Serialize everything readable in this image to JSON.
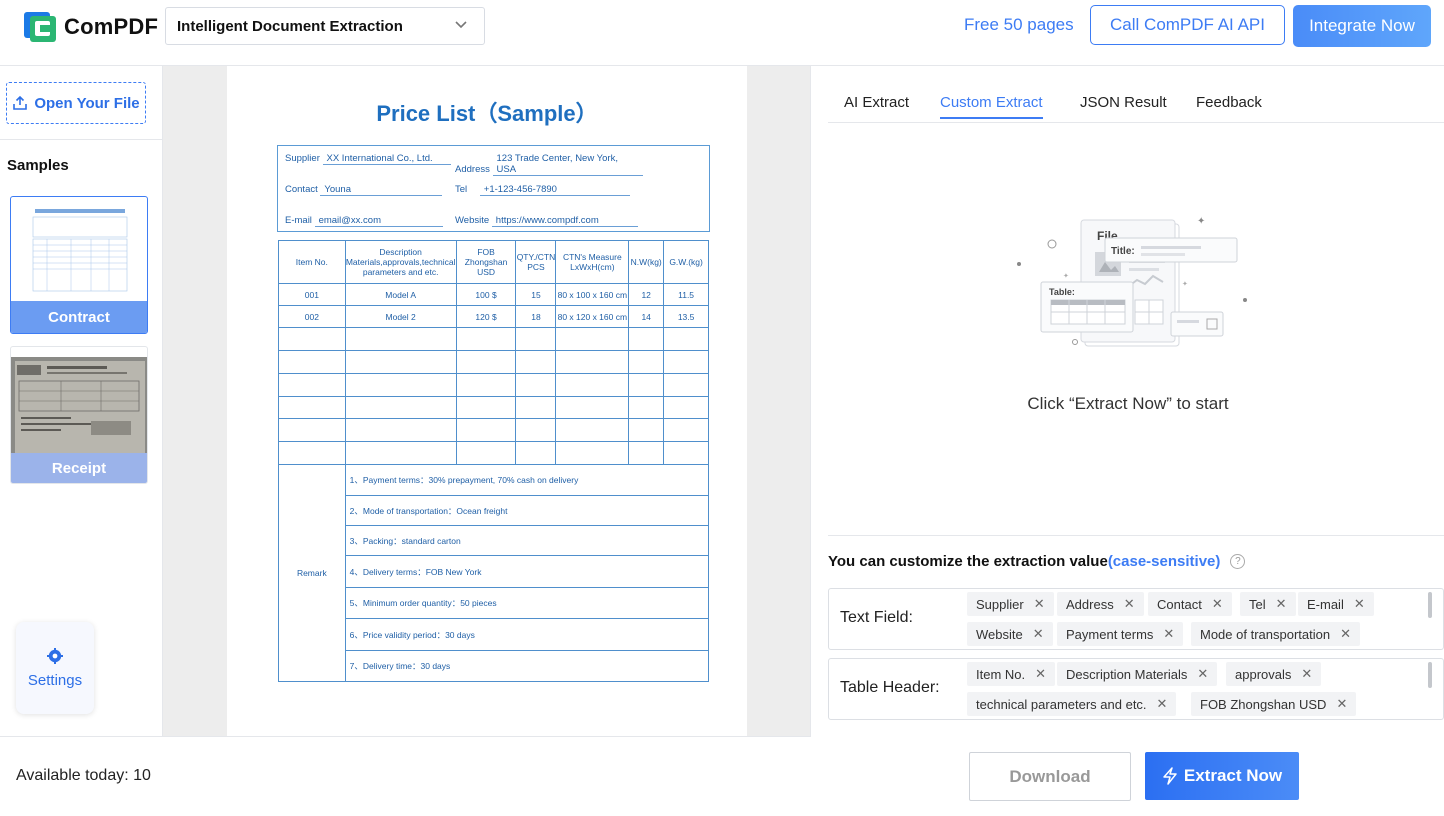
{
  "header": {
    "brand": "ComPDF",
    "mode_select": "Intelligent Document Extraction",
    "free_pages": "Free 50 pages",
    "api_button": "Call ComPDF AI API",
    "integrate_button": "Integrate Now"
  },
  "sidebar": {
    "open_file": "Open Your File",
    "samples_label": "Samples",
    "samples": [
      {
        "label": "Contract",
        "selected": true
      },
      {
        "label": "Receipt",
        "selected": false
      }
    ],
    "settings": "Settings"
  },
  "document": {
    "title": "Price List（Sample）",
    "info": {
      "supplier_label": "Supplier",
      "supplier_value": "XX International Co., Ltd.",
      "address_label": "Address",
      "address_value": "123 Trade Center, New York, USA",
      "contact_label": "Contact",
      "contact_value": "Youna",
      "tel_label": "Tel",
      "tel_value": "+1-123-456-7890",
      "email_label": "E-mail",
      "email_value": "email@xx.com",
      "website_label": "Website",
      "website_value": "https://www.compdf.com"
    },
    "table_headers": [
      "Item No.",
      "Description Materials,approvals,technical parameters and etc.",
      "FOB Zhongshan USD",
      "QTY./CTN PCS",
      "CTN's Measure LxWxH(cm)",
      "N.W(kg)",
      "G.W.(kg)"
    ],
    "rows": [
      [
        "001",
        "Model A",
        "100 $",
        "15",
        "80 x 100 x 160 cm",
        "12",
        "11.5"
      ],
      [
        "002",
        "Model 2",
        "120 $",
        "18",
        "80 x 120 x 160 cm",
        "14",
        "13.5"
      ]
    ],
    "remark_label": "Remark",
    "remarks": [
      "1、Payment terms：30% prepayment, 70% cash on delivery",
      "2、Mode of transportation：Ocean freight",
      "3、Packing：standard carton",
      "4、Delivery terms：FOB New York",
      "5、Minimum order quantity：50 pieces",
      "6、Price validity period：30 days",
      "7、Delivery time：30 days"
    ]
  },
  "status": {
    "available_today": "Available today: 10"
  },
  "right_panel": {
    "tabs": [
      {
        "label": "AI Extract",
        "active": false
      },
      {
        "label": "Custom Extract",
        "active": true
      },
      {
        "label": "JSON Result",
        "active": false
      },
      {
        "label": "Feedback",
        "active": false
      }
    ],
    "illustration": {
      "file_label": "File",
      "title_label": "Title:",
      "table_label": "Table:"
    },
    "hint": "Click “Extract Now” to start",
    "customize_text": "You can customize the extraction value",
    "customize_cs": "(case-sensitive)",
    "text_field_label": "Text Field:",
    "text_field_tags": [
      "Supplier",
      "Address",
      "Contact",
      "Tel",
      "E-mail",
      "Website",
      "Payment terms",
      "Mode of transportation"
    ],
    "table_header_label": "Table Header:",
    "table_header_tags": [
      "Item No.",
      "Description Materials",
      "approvals",
      "technical parameters and etc.",
      "FOB Zhongshan USD"
    ],
    "download_button": "Download",
    "extract_button": "Extract Now"
  },
  "colors": {
    "accent": "#3d7cf4",
    "doc_blue": "#1f6fbf",
    "brand_green": "#2bb673"
  }
}
